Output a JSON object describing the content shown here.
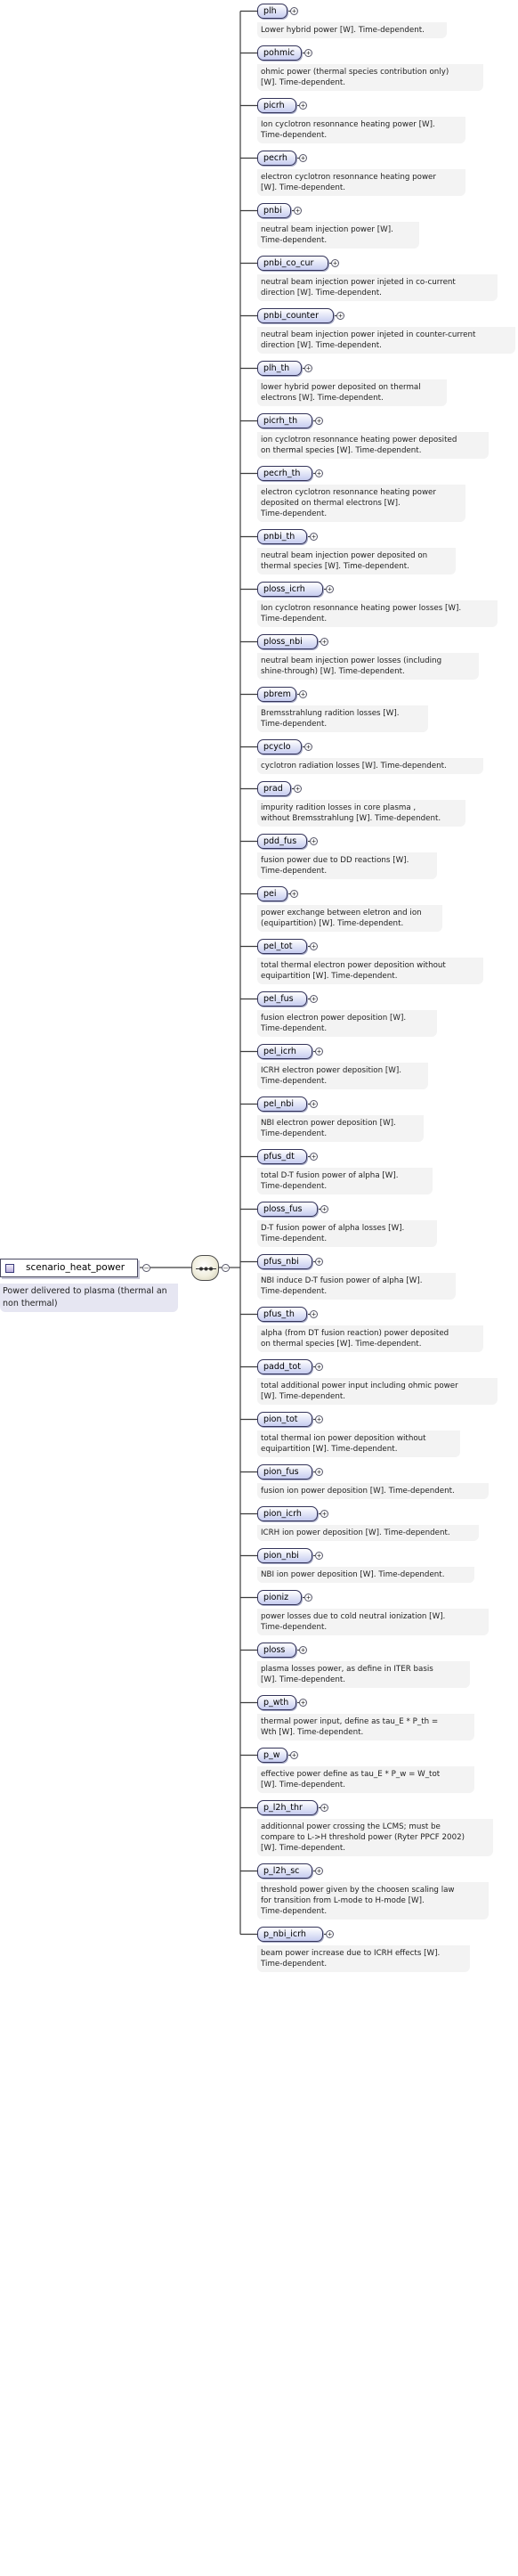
{
  "root": {
    "name": "scenario_heat_power",
    "description": "Power delivered to plasma (thermal an non thermal)"
  },
  "colors": {
    "line": "#3c3c3c",
    "box_gradient_top": "#ffffff",
    "box_gradient_bottom": "#c6ccf0",
    "doc_background": "#f3f3f3",
    "root_doc_background": "#e6e6f2"
  },
  "elements": [
    {
      "name": "plh",
      "doc": [
        "Lower hybrid power [W]. Time-dependent."
      ]
    },
    {
      "name": "pohmic",
      "doc": [
        "ohmic power (thermal species contribution only)",
        "[W]. Time-dependent."
      ]
    },
    {
      "name": "picrh",
      "doc": [
        "Ion cyclotron resonnance heating power [W].",
        "Time-dependent."
      ]
    },
    {
      "name": "pecrh",
      "doc": [
        "electron cyclotron resonnance heating power",
        "[W]. Time-dependent."
      ]
    },
    {
      "name": "pnbi",
      "doc": [
        "neutral beam injection power [W].",
        "Time-dependent."
      ]
    },
    {
      "name": "pnbi_co_cur",
      "doc": [
        "neutral beam injection power injeted in co-current",
        "direction [W]. Time-dependent."
      ]
    },
    {
      "name": "pnbi_counter",
      "doc": [
        "neutral beam injection power injeted in counter-current",
        "direction [W]. Time-dependent."
      ]
    },
    {
      "name": "plh_th",
      "doc": [
        "lower hybrid power deposited on thermal",
        "electrons [W]. Time-dependent."
      ]
    },
    {
      "name": "picrh_th",
      "doc": [
        "ion cyclotron resonnance heating power deposited",
        "on thermal species [W]. Time-dependent."
      ]
    },
    {
      "name": "pecrh_th",
      "doc": [
        "electron cyclotron resonnance heating power",
        "deposited on thermal electrons [W].",
        "Time-dependent."
      ]
    },
    {
      "name": "pnbi_th",
      "doc": [
        "neutral beam injection power deposited on",
        "thermal species [W]. Time-dependent."
      ]
    },
    {
      "name": "ploss_icrh",
      "doc": [
        "Ion cyclotron resonnance heating power losses [W].",
        "Time-dependent."
      ]
    },
    {
      "name": "ploss_nbi",
      "doc": [
        "neutral beam injection power losses (including",
        "shine-through) [W]. Time-dependent."
      ]
    },
    {
      "name": "pbrem",
      "doc": [
        "Bremsstrahlung radition losses [W].",
        "Time-dependent."
      ]
    },
    {
      "name": "pcyclo",
      "doc": [
        "cyclotron radiation losses [W]. Time-dependent."
      ]
    },
    {
      "name": "prad",
      "doc": [
        "impurity radition losses in core plasma ,",
        "without Bremsstrahlung [W]. Time-dependent."
      ]
    },
    {
      "name": "pdd_fus",
      "doc": [
        "fusion power due to DD reactions [W].",
        "Time-dependent."
      ]
    },
    {
      "name": "pei",
      "doc": [
        "power exchange between eletron and ion",
        "(equipartition) [W]. Time-dependent."
      ]
    },
    {
      "name": "pel_tot",
      "doc": [
        "total thermal electron power deposition without",
        "equipartition [W]. Time-dependent."
      ]
    },
    {
      "name": "pel_fus",
      "doc": [
        "fusion electron power deposition [W].",
        "Time-dependent."
      ]
    },
    {
      "name": "pel_icrh",
      "doc": [
        "ICRH electron power deposition [W].",
        "Time-dependent."
      ]
    },
    {
      "name": "pel_nbi",
      "doc": [
        "NBI electron power deposition [W].",
        "Time-dependent."
      ]
    },
    {
      "name": "pfus_dt",
      "doc": [
        "total D-T fusion power of alpha [W].",
        "Time-dependent."
      ]
    },
    {
      "name": "ploss_fus",
      "doc": [
        "D-T fusion power of alpha losses [W].",
        "Time-dependent."
      ]
    },
    {
      "name": "pfus_nbi",
      "doc": [
        "NBI induce D-T fusion power of alpha [W].",
        "Time-dependent."
      ]
    },
    {
      "name": "pfus_th",
      "doc": [
        "alpha (from DT fusion reaction) power deposited",
        "on thermal species [W]. Time-dependent."
      ]
    },
    {
      "name": "padd_tot",
      "doc": [
        "total additional power input including ohmic power",
        "[W]. Time-dependent."
      ]
    },
    {
      "name": "pion_tot",
      "doc": [
        "total thermal ion power deposition without",
        "equipartition [W]. Time-dependent."
      ]
    },
    {
      "name": "pion_fus",
      "doc": [
        "fusion ion power deposition [W]. Time-dependent."
      ]
    },
    {
      "name": "pion_icrh",
      "doc": [
        "ICRH ion power deposition [W]. Time-dependent."
      ]
    },
    {
      "name": "pion_nbi",
      "doc": [
        "NBI ion power deposition [W]. Time-dependent."
      ]
    },
    {
      "name": "pioniz",
      "doc": [
        "power losses due to cold neutral ionization [W].",
        "Time-dependent."
      ]
    },
    {
      "name": "ploss",
      "doc": [
        "plasma losses power, as define in ITER basis",
        "[W]. Time-dependent."
      ]
    },
    {
      "name": "p_wth",
      "doc": [
        "thermal power input, define as tau_E * P_th =",
        "Wth [W]. Time-dependent."
      ]
    },
    {
      "name": "p_w",
      "doc": [
        "effective power define as tau_E * P_w = W_tot",
        "[W]. Time-dependent."
      ]
    },
    {
      "name": "p_l2h_thr",
      "doc": [
        "additionnal power crossing the LCMS; must be",
        "compare to L->H threshold power (Ryter PPCF 2002)",
        "[W]. Time-dependent."
      ]
    },
    {
      "name": "p_l2h_sc",
      "doc": [
        "threshold power given by the choosen scaling law",
        "for transition from L-mode to H-mode [W].",
        "Time-dependent."
      ]
    },
    {
      "name": "p_nbi_icrh",
      "doc": [
        "beam power increase due to ICRH effects [W].",
        "Time-dependent."
      ]
    }
  ]
}
